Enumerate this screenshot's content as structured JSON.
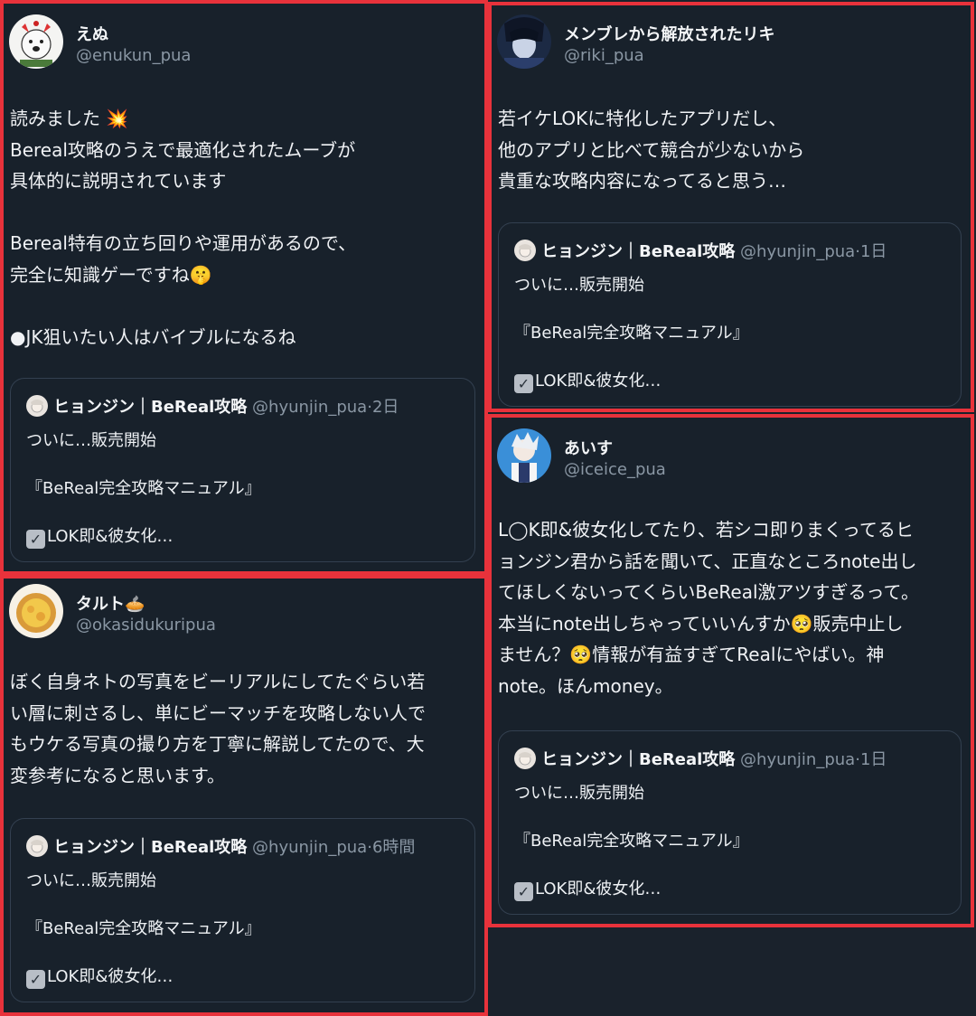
{
  "quoted_tweet": {
    "name": "ヒョンジン｜BeReal攻略",
    "handle": "@hyunjin_pua",
    "line1": "ついに…販売開始",
    "line2": "『BeReal完全攻略マニュアル』",
    "line3": "LOK即&彼女化…"
  },
  "posts": [
    {
      "name": "えぬ",
      "handle": "@enukun_pua",
      "body": [
        "読みました 💥",
        "Bereal攻略のうえで最適化されたムーブが",
        "具体的に説明されています",
        "",
        "Bereal特有の立ち回りや運用があるので、",
        "完全に知識ゲーですね🤫",
        "",
        "●JK狙いたい人はバイブルになるね"
      ],
      "quote_time": "2日"
    },
    {
      "name": "タルト🥧",
      "handle": "@okasidukuripua",
      "body": [
        "ぼく自身ネトの写真をビーリアルにしてたぐらい若",
        "い層に刺さるし、単にビーマッチを攻略しない人で",
        "もウケる写真の撮り方を丁寧に解説してたので、大",
        "変参考になると思います。"
      ],
      "quote_time": "6時間"
    },
    {
      "name": "メンブレから解放されたリキ",
      "handle": "@riki_pua",
      "body": [
        "若イケLOKに特化したアプリだし、",
        "他のアプリと比べて競合が少ないから",
        "貴重な攻略内容になってると思う…"
      ],
      "quote_time": "1日"
    },
    {
      "name": "あいす",
      "handle": "@iceice_pua",
      "body": [
        "L◯K即&彼女化してたり、若シコ即りまくってるヒ",
        "ョンジン君から話を聞いて、正直なところnote出し",
        "てほしくないってくらいBeReal激アツすぎるって。",
        "本当にnote出しちゃっていいんすか🥺販売中止し",
        "ません？🥺情報が有益すぎてRealにやばい。神",
        "note。ほんmoney。"
      ],
      "quote_time": "1日"
    }
  ],
  "colors": {
    "background": "#18212b",
    "highlight_border": "#e8323b",
    "muted_text": "#8a97a4",
    "quote_border": "#334050"
  }
}
